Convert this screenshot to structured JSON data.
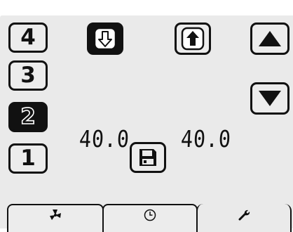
{
  "levels": [
    "4",
    "3",
    "2",
    "1"
  ],
  "selected_level": "2",
  "icons": {
    "down": "down-arrow-icon",
    "up": "up-arrow-icon",
    "raise": "triangle-up-icon",
    "lower": "triangle-down-icon",
    "save": "floppy-disk-icon"
  },
  "readouts": {
    "left": "40.0",
    "right": "40.0"
  },
  "tabs": [
    {
      "name": "fan-icon",
      "active": false
    },
    {
      "name": "clock-icon",
      "active": false
    },
    {
      "name": "wrench-icon",
      "active": true
    }
  ],
  "colors": {
    "panel": "#eaeaea",
    "ink": "#111111"
  }
}
